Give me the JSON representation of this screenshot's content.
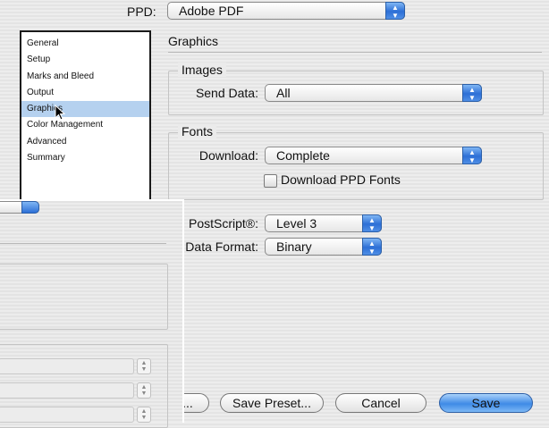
{
  "ppd": {
    "label": "PPD:",
    "value": "Adobe PDF"
  },
  "sidebar": {
    "items": [
      {
        "label": "General"
      },
      {
        "label": "Setup"
      },
      {
        "label": "Marks and Bleed"
      },
      {
        "label": "Output"
      },
      {
        "label": "Graphics",
        "selected": true
      },
      {
        "label": "Color Management"
      },
      {
        "label": "Advanced"
      },
      {
        "label": "Summary"
      }
    ]
  },
  "main": {
    "title": "Graphics",
    "images": {
      "group_label": "Images",
      "send_data_label": "Send Data:",
      "send_data_value": "All"
    },
    "fonts": {
      "group_label": "Fonts",
      "download_label": "Download:",
      "download_value": "Complete",
      "ppd_fonts_label": "Download PPD Fonts",
      "ppd_fonts_checked": false
    },
    "postscript_label": "PostScript®:",
    "postscript_value": "Level 3",
    "data_format_label": "Data Format:",
    "data_format_value": "Binary"
  },
  "buttons": {
    "partial_label": "...",
    "save_preset": "Save Preset...",
    "cancel": "Cancel",
    "save": "Save"
  },
  "colors": {
    "accent": "#3f8ae6",
    "selection": "#b5d1ef"
  },
  "icons": {
    "popup_arrow": "up-down-arrows-icon",
    "cursor": "mouse-pointer-icon"
  }
}
